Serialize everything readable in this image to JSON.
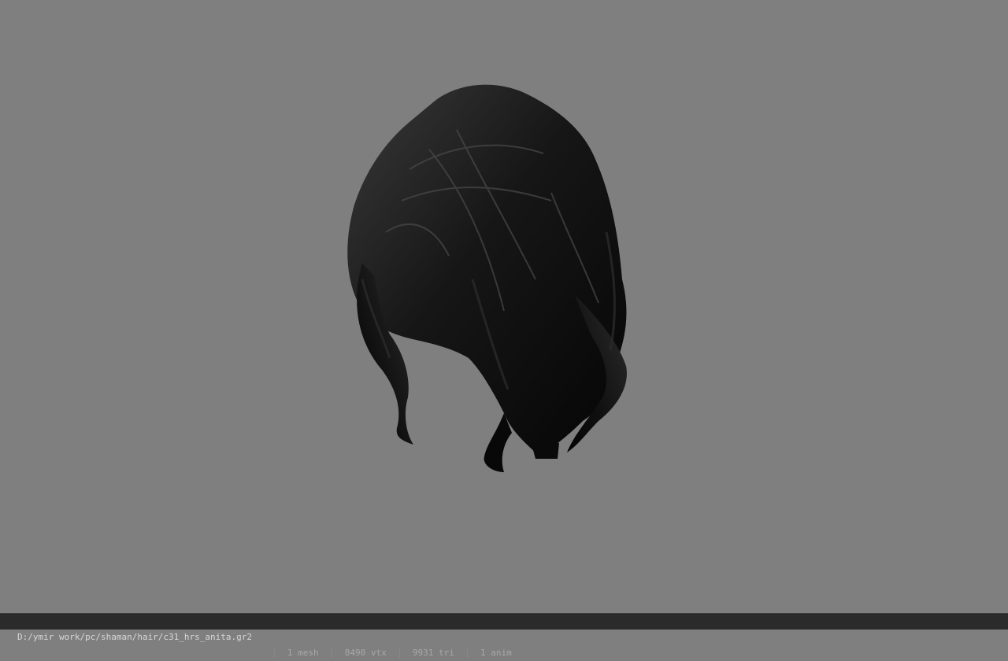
{
  "viewport": {
    "background_color": "#7f7f7f",
    "model_color": "#0d0d0d",
    "model_label": "hair-model"
  },
  "statusbar": {
    "file_path": "D:/ymir work/pc/shaman/hair/c31_hrs_anita.gr2",
    "separator": "|",
    "mesh": "1 mesh",
    "vtx": "8490 vtx",
    "tri": "9931 tri",
    "anim": "1 anim",
    "background_color": "#2b2b2b"
  }
}
